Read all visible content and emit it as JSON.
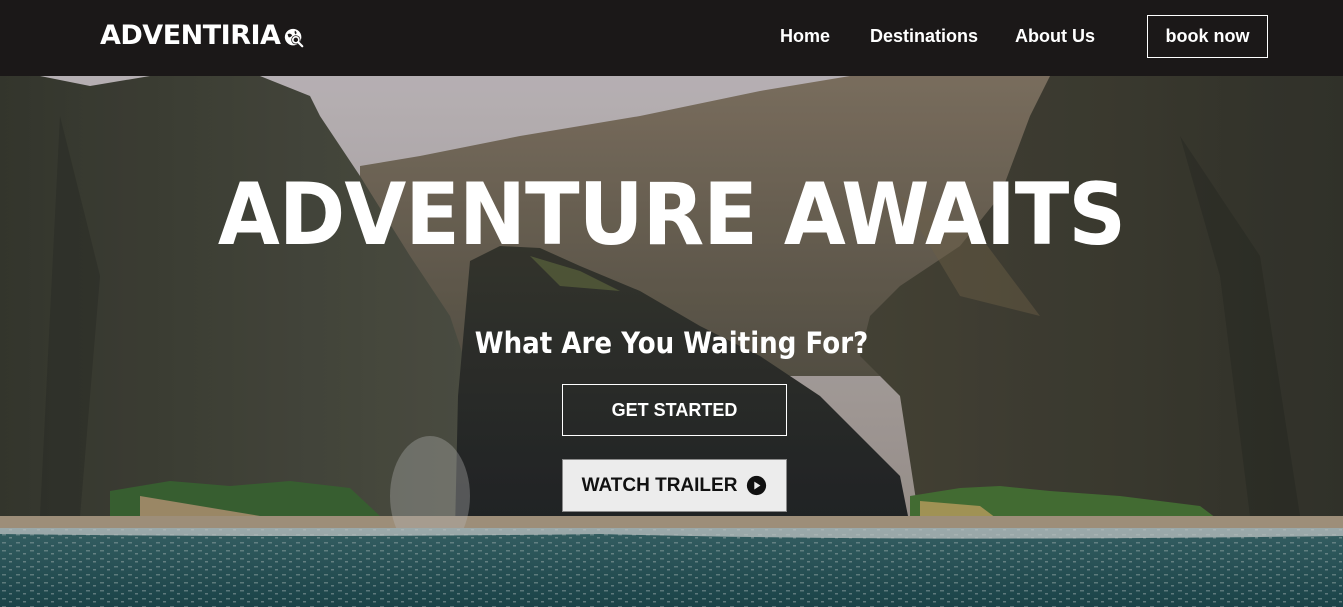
{
  "brand": {
    "name": "ADVENTIRIA",
    "icon": "globe-search-icon"
  },
  "nav": {
    "links": [
      {
        "label": "Home"
      },
      {
        "label": "Destinations"
      },
      {
        "label": "About Us"
      }
    ],
    "cta_label": "book now"
  },
  "hero": {
    "title": "ADVENTURE AWAITS",
    "subtitle": "What Are You Waiting For?",
    "primary_button_label": "GET STARTED",
    "secondary_button_label": "WATCH TRAILER",
    "secondary_button_icon": "play-circle-icon",
    "background": "mountain-coast-photo"
  },
  "colors": {
    "navbar_bg": "#1b1818",
    "text_light": "#ffffff",
    "button_light_bg": "#ececec",
    "sea": "#2c5a5e"
  }
}
